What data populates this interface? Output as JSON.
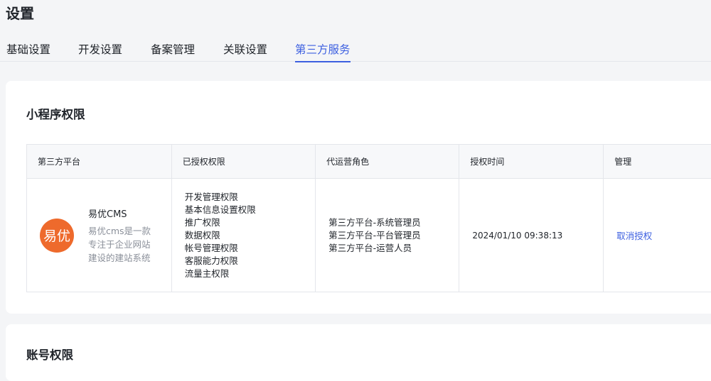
{
  "page": {
    "title": "设置"
  },
  "tabs": [
    {
      "label": "基础设置"
    },
    {
      "label": "开发设置"
    },
    {
      "label": "备案管理"
    },
    {
      "label": "关联设置"
    },
    {
      "label": "第三方服务",
      "active": true
    }
  ],
  "mini_program": {
    "title": "小程序权限",
    "columns": [
      "第三方平台",
      "已授权权限",
      "代运营角色",
      "授权时间",
      "管理"
    ],
    "row": {
      "logo_text": "易优",
      "platform_name": "易优CMS",
      "platform_desc": "易优cms是一款专注于企业网站建设的建站系统",
      "permissions": [
        "开发管理权限",
        "基本信息设置权限",
        "推广权限",
        "数据权限",
        "帐号管理权限",
        "客服能力权限",
        "流量主权限"
      ],
      "roles": [
        "第三方平台-系统管理员",
        "第三方平台-平台管理员",
        "第三方平台-运营人员"
      ],
      "auth_time": "2024/01/10 09:38:13",
      "action": "取消授权"
    }
  },
  "account": {
    "title": "账号权限"
  },
  "colors": {
    "accent": "#3c5fe0",
    "logo_bg": "#ee6a2c"
  }
}
